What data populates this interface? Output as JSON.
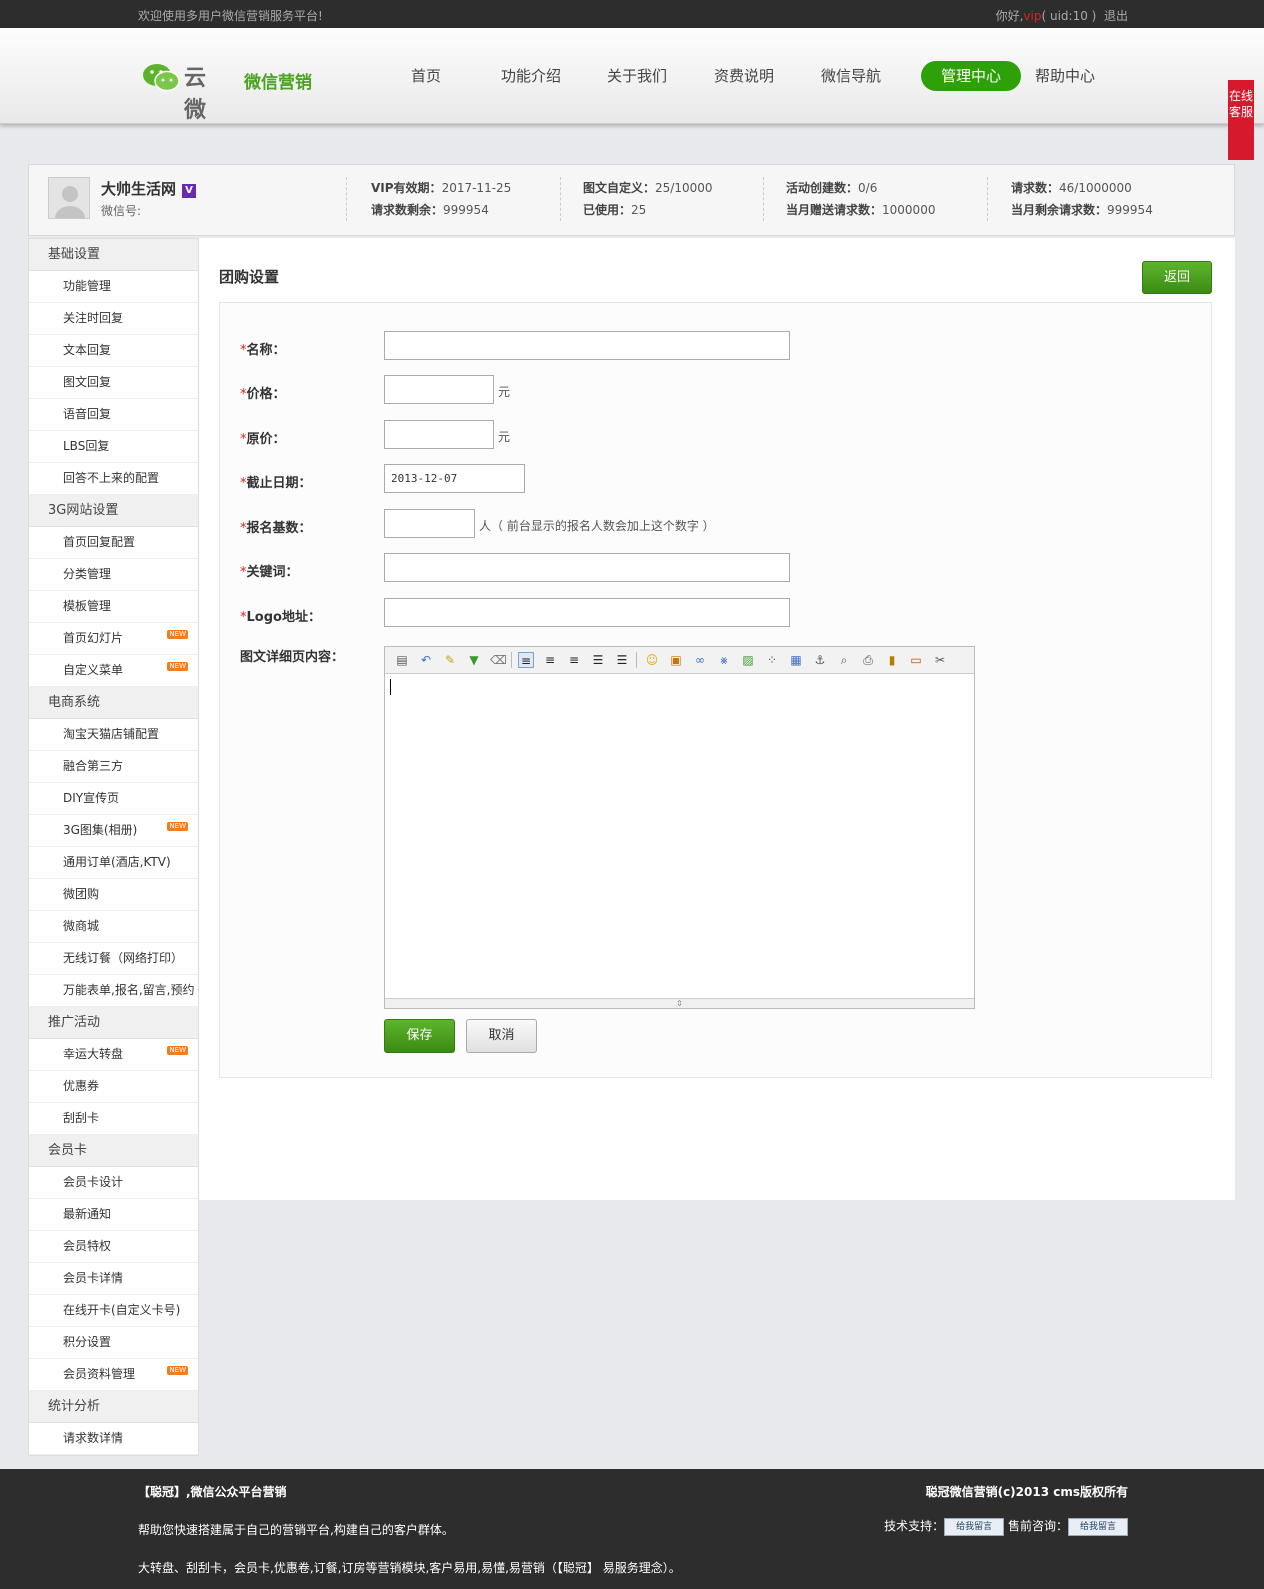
{
  "topbar": {
    "welcome": "欢迎使用多用户微信营销服务平台!",
    "greeting": "你好,",
    "vip": "vip",
    "uid": "( uid:10 )",
    "logout": "退出"
  },
  "logo": {
    "yun": "云微",
    "name": "微信营销"
  },
  "nav": [
    "首页",
    "功能介绍",
    "关于我们",
    "资费说明",
    "微信导航",
    "管理中心",
    "帮助中心"
  ],
  "service": "在线客服",
  "profile": {
    "name": "大帅生活网",
    "vbadge": "V",
    "wechat": "微信号:",
    "vip_label": "VIP有效期：",
    "vip_value": "2017-11-25",
    "remain_label": "请求数剩余：",
    "remain_value": "999954",
    "tw_label": "图文自定义：",
    "tw_value": "25/10000",
    "used_label": "已使用：",
    "used_value": "25",
    "act_label": "活动创建数：",
    "act_value": "0/6",
    "gift_label": "当月赠送请求数：",
    "gift_value": "1000000",
    "req_label": "请求数：",
    "req_value": "46/1000000",
    "month_label": "当月剩余请求数：",
    "month_value": "999954"
  },
  "sidebar": [
    {
      "group": "基础设置",
      "items": [
        {
          "label": "功能管理"
        },
        {
          "label": "关注时回复"
        },
        {
          "label": "文本回复"
        },
        {
          "label": "图文回复"
        },
        {
          "label": "语音回复"
        },
        {
          "label": "LBS回复"
        },
        {
          "label": "回答不上来的配置"
        }
      ]
    },
    {
      "group": "3G网站设置",
      "items": [
        {
          "label": "首页回复配置"
        },
        {
          "label": "分类管理"
        },
        {
          "label": "模板管理"
        },
        {
          "label": "首页幻灯片",
          "new": true
        },
        {
          "label": "自定义菜单",
          "new": true
        }
      ]
    },
    {
      "group": "电商系统",
      "items": [
        {
          "label": "淘宝天猫店铺配置"
        },
        {
          "label": "融合第三方"
        },
        {
          "label": "DIY宣传页"
        },
        {
          "label": "3G图集(相册)",
          "new": true
        },
        {
          "label": "通用订单(酒店,KTV)"
        },
        {
          "label": "微团购"
        },
        {
          "label": "微商城"
        },
        {
          "label": "无线订餐（网络打印）"
        },
        {
          "label": "万能表单,报名,留言,预约"
        }
      ]
    },
    {
      "group": "推广活动",
      "items": [
        {
          "label": "幸运大转盘",
          "new": true
        },
        {
          "label": "优惠券"
        },
        {
          "label": "刮刮卡"
        }
      ]
    },
    {
      "group": "会员卡",
      "items": [
        {
          "label": "会员卡设计"
        },
        {
          "label": "最新通知"
        },
        {
          "label": "会员特权"
        },
        {
          "label": "会员卡详情"
        },
        {
          "label": "在线开卡(自定义卡号)"
        },
        {
          "label": "积分设置"
        },
        {
          "label": "会员资料管理",
          "new": true
        }
      ]
    },
    {
      "group": "统计分析",
      "items": [
        {
          "label": "请求数详情"
        }
      ]
    }
  ],
  "new_tag": "NEW",
  "main": {
    "title": "团购设置",
    "back": "返回",
    "req_mark": "*",
    "name_label": "名称：",
    "price_label": "价格：",
    "price_unit": "元",
    "orig_label": "原价：",
    "orig_unit": "元",
    "date_label": "截止日期：",
    "date_value": "2013-12-07",
    "base_label": "报名基数：",
    "base_hint": "人（ 前台显示的报名人数会加上这个数字 ）",
    "kw_label": "关键词：",
    "logo_label": "Logo地址：",
    "detail_label": "图文详细页内容：",
    "save": "保存",
    "cancel": "取消"
  },
  "footer": {
    "line1_left": "【聪冠】,微信公众平台营销",
    "line1_right": "聪冠微信营销(c)2013 cms版权所有",
    "line2_left": "帮助您快速搭建属于自己的营销平台,构建自己的客户群体。",
    "tech_label": "技术支持：",
    "presale_label": "售前咨询：",
    "qq_button": "给我留言",
    "line3_left": "大转盘、刮刮卡，会员卡,优惠卷,订餐,订房等营销模块,客户易用,易懂,易营销（【聪冠】 易服务理念）。"
  }
}
